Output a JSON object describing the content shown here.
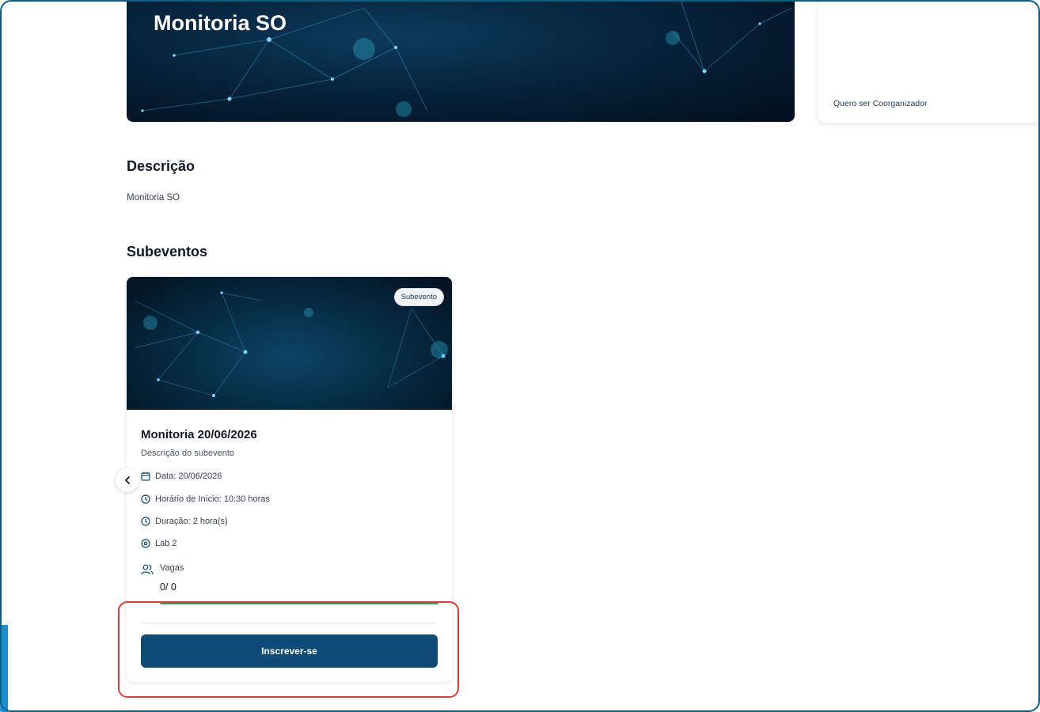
{
  "event": {
    "title": "Monitoria SO"
  },
  "sidebar": {
    "coorganizer_link": "Quero ser Coorganizador"
  },
  "description": {
    "heading": "Descrição",
    "text": "Monitoria SO"
  },
  "subevents": {
    "heading": "Subeventos",
    "items": [
      {
        "badge": "Subevento",
        "title": "Monitoria 20/06/2026",
        "description": "Descrição do subevento",
        "date": "Data: 20/06/2026",
        "start_time": "Horário de Início: 10:30 horas",
        "duration": "Duração: 2 hora(s)",
        "location": "Lab 2",
        "vagas_label": "Vagas",
        "vagas_value": "0/ 0",
        "progress_fraction": 1.0,
        "progress_color": "#22a652",
        "button_label": "Inscrever-se"
      }
    ]
  },
  "colors": {
    "primary": "#0f4c75",
    "frame": "#0b5f80",
    "highlight": "#e53935"
  },
  "icons": {
    "prev": "chevron-left-icon",
    "date": "calendar-icon",
    "time": "clock-icon",
    "duration": "clock-icon",
    "location": "map-pin-icon",
    "vagas": "users-icon"
  }
}
